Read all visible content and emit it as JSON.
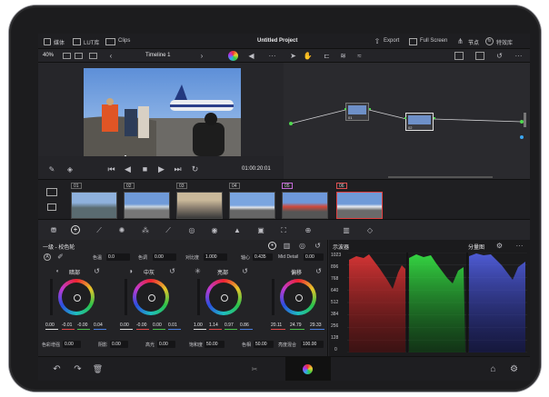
{
  "topbar": {
    "media_label": "媒体",
    "lut_label": "LUT库",
    "clips_label": "Clips",
    "project_title": "Untitled Project",
    "export_label": "Export",
    "fullscreen_label": "Full Screen",
    "nodes_label": "节点",
    "effects_label": "特效库"
  },
  "toolbar": {
    "zoom": "40%",
    "timeline_name": "Timeline 1"
  },
  "transport": {
    "timecode": "01:00:20:01"
  },
  "node_graph": {
    "node1_label": "01",
    "node2_label": "02"
  },
  "clips": [
    {
      "number": "01"
    },
    {
      "number": "02"
    },
    {
      "number": "03"
    },
    {
      "number": "04"
    },
    {
      "number": "05"
    },
    {
      "number": "06"
    }
  ],
  "primary": {
    "title": "一级 - 校色轮",
    "temp_label": "色温",
    "temp_value": "0.0",
    "tint_label": "色调",
    "tint_value": "0.00",
    "contrast_label": "对比度",
    "contrast_value": "1.000",
    "pivot_label": "轴心",
    "pivot_value": "0.435",
    "middetail_label": "Mid Detail",
    "middetail_value": "0.00",
    "wheels": [
      {
        "name": "暗部",
        "values": [
          "0.00",
          "-0.01",
          "-0.00",
          "0.04"
        ]
      },
      {
        "name": "中灰",
        "values": [
          "0.00",
          "-0.00",
          "0.00",
          "0.01"
        ]
      },
      {
        "name": "亮部",
        "values": [
          "1.00",
          "1.14",
          "0.97",
          "0.86"
        ]
      },
      {
        "name": "偏移",
        "values": [
          "20.11",
          "24.79",
          "29.33"
        ]
      }
    ],
    "bottom": {
      "colorboost_label": "色彩增强",
      "colorboost_value": "0.00",
      "shadows_label": "阴影",
      "shadows_value": "0.00",
      "highlights_label": "高光",
      "highlights_value": "0.00",
      "saturation_label": "饱和度",
      "saturation_value": "50.00",
      "hue_label": "色相",
      "hue_value": "50.00",
      "lummix_label": "亮度混合",
      "lummix_value": "100.00"
    }
  },
  "scope": {
    "title": "示波器",
    "mode": "分量图",
    "ticks": [
      "1023",
      "896",
      "768",
      "640",
      "512",
      "384",
      "256",
      "128",
      "0"
    ]
  }
}
